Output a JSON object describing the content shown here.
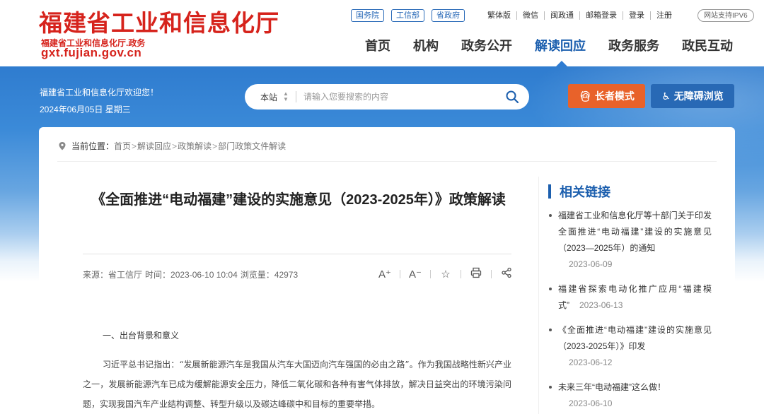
{
  "header": {
    "logo_title": "福建省工业和信息化厅",
    "logo_sub": "福建省工业和信息化厅.政务",
    "logo_url": "gxt.fujian.gov.cn",
    "tag_buttons": [
      "国务院",
      "工信部",
      "省政府"
    ],
    "top_links": [
      "繁体版",
      "微信",
      "闽政通",
      "邮箱登录",
      "登录",
      "注册"
    ],
    "ipv6_badge": "网站支持IPV6",
    "nav": [
      "首页",
      "机构",
      "政务公开",
      "解读回应",
      "政务服务",
      "政民互动"
    ],
    "nav_active": "解读回应"
  },
  "banner": {
    "welcome": "福建省工业和信息化厅欢迎您！",
    "date": "2024年06月05日 星期三",
    "search_scope": "本站",
    "search_placeholder": "请输入您要搜索的内容",
    "elder_mode": "长者模式",
    "accessible": "无障碍浏览"
  },
  "breadcrumb": {
    "label": "当前位置：",
    "items": [
      "首页",
      "解读回应",
      "政策解读",
      "部门政策文件解读"
    ],
    "separator": ">"
  },
  "article": {
    "title": "《全面推进“电动福建”建设的实施意见（2023-2025年）》政策解读",
    "source": "来源：省工信厅",
    "time": "时间：2023-06-10 10:04",
    "views": "浏览量：42973",
    "tools": [
      "A⁺",
      "A⁻",
      "☆",
      "⎙",
      "share"
    ],
    "section_heading": "一、出台背景和意义",
    "paragraph": "习近平总书记指出：“发展新能源汽车是我国从汽车大国迈向汽车强国的必由之路”。作为我国战略性新兴产业之一，发展新能源汽车已成为缓解能源安全压力，降低二氧化碳和各种有害气体排放，解决日益突出的环境污染问题，实现我国汽车产业结构调整、转型升级以及碳达峰碳中和目标的重要举措。"
  },
  "sidebar": {
    "title": "相关链接",
    "items": [
      {
        "text": "福建省工业和信息化厅等十部门关于印发全面推进“电动福建”建设的实施意见（2023—2025年）的通知",
        "date": "2023-06-09"
      },
      {
        "text": "福建省探索电动化推广应用“福建模式”",
        "date": "2023-06-13"
      },
      {
        "text": "《全面推进“电动福建”建设的实施意见（2023-2025年）》印发",
        "date": "2023-06-12"
      },
      {
        "text": "未来三年“电动福建”这么做！",
        "date": "2023-06-10"
      }
    ]
  },
  "colors": {
    "brand_red": "#d6231c",
    "brand_blue": "#1c5fae",
    "elder_orange": "#e8622a",
    "access_blue": "#2869b5"
  }
}
